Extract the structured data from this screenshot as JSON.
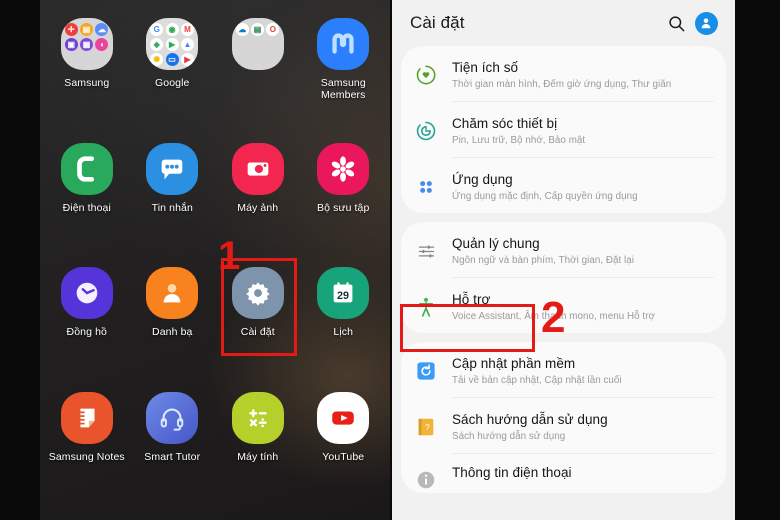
{
  "home_screen": {
    "apps": [
      {
        "label": "Samsung",
        "type": "folder",
        "icon_name": "samsung-folder-icon",
        "mini_icons": [
          {
            "name": "samsung-health-icon",
            "color": "#e8413c",
            "char": "+"
          },
          {
            "name": "samsung-notes-icon",
            "color": "#f5a623",
            "char": ""
          },
          {
            "name": "samsung-cloud-icon",
            "color": "#5b8df6",
            "char": ""
          },
          {
            "name": "galaxy-store-icon",
            "color": "#6d3fd6",
            "char": ""
          },
          {
            "name": "samsung-pay-icon",
            "color": "#7b4fd9",
            "char": ""
          },
          {
            "name": "samsung-tv-icon",
            "color": "#e8469c",
            "char": ""
          }
        ]
      },
      {
        "label": "Google",
        "type": "folder",
        "icon_name": "google-folder-icon",
        "mini_icons": [
          {
            "name": "google-search-icon",
            "color": "#ffffff",
            "char": "G"
          },
          {
            "name": "chrome-icon",
            "color": "#34a853",
            "char": ""
          },
          {
            "name": "gmail-icon",
            "color": "#ea4335",
            "char": "M"
          },
          {
            "name": "google-maps-icon",
            "color": "#ffffff",
            "char": ""
          },
          {
            "name": "play-store-icon",
            "color": "#ffffff",
            "char": ""
          },
          {
            "name": "google-drive-icon",
            "color": "#ffffff",
            "char": ""
          },
          {
            "name": "google-photos-icon",
            "color": "#ffffff",
            "char": ""
          },
          {
            "name": "google-duo-icon",
            "color": "#1a73e8",
            "char": ""
          },
          {
            "name": "google-play-movies-icon",
            "color": "#e53935",
            "char": ""
          }
        ]
      },
      {
        "label": "",
        "type": "folder",
        "icon_name": "microsoft-folder-icon",
        "mini_icons": [
          {
            "name": "onedrive-icon",
            "color": "#0f7ec8",
            "char": ""
          },
          {
            "name": "excel-icon",
            "color": "#1b7d4b",
            "char": ""
          },
          {
            "name": "office-icon",
            "color": "#e8413c",
            "char": "O"
          }
        ]
      },
      {
        "label": "Samsung Members",
        "type": "app",
        "icon_name": "samsung-members-icon",
        "color": "#2d7ff9"
      },
      {
        "label": "Điện thoại",
        "type": "app",
        "icon_name": "phone-icon",
        "color": "#2ba85c"
      },
      {
        "label": "Tin nhắn",
        "type": "app",
        "icon_name": "messages-icon",
        "color": "#2d8fe0"
      },
      {
        "label": "Máy ảnh",
        "type": "app",
        "icon_name": "camera-icon",
        "color": "#f0274f"
      },
      {
        "label": "Bộ sưu tập",
        "type": "app",
        "icon_name": "gallery-icon",
        "color": "#e8185d"
      },
      {
        "label": "Đồng hồ",
        "type": "app",
        "icon_name": "clock-icon",
        "color": "#5535d6"
      },
      {
        "label": "Danh bạ",
        "type": "app",
        "icon_name": "contacts-icon",
        "color": "#f58220"
      },
      {
        "label": "Cài đặt",
        "type": "app",
        "icon_name": "settings-gear-icon",
        "color": "#7e93ab"
      },
      {
        "label": "Lịch",
        "type": "app",
        "icon_name": "calendar-icon",
        "color": "#1aa37a",
        "badge": "29"
      },
      {
        "label": "Samsung Notes",
        "type": "app",
        "icon_name": "samsung-notes-icon",
        "color": "#e8552e"
      },
      {
        "label": "Smart Tutor",
        "type": "app",
        "icon_name": "smart-tutor-icon",
        "color": "#4f73d9"
      },
      {
        "label": "Máy tính",
        "type": "app",
        "icon_name": "calculator-icon",
        "color": "#b5cf2e"
      },
      {
        "label": "YouTube",
        "type": "app",
        "icon_name": "youtube-icon",
        "color": "#ffffff"
      }
    ]
  },
  "annotations": {
    "step1_number": "1",
    "step1_target": "Cài đặt",
    "step2_number": "2",
    "step2_target": "Hỗ trợ",
    "highlight_color": "#e01b17"
  },
  "settings": {
    "header": {
      "title": "Cài đặt",
      "search_icon": "search-icon",
      "account_icon": "account-avatar-icon"
    },
    "groups": [
      {
        "group_name": "digital-wellbeing-group",
        "items": [
          {
            "title": "Tiện ích số",
            "subtitle": "Thời gian màn hình, Đếm giờ ứng dụng, Thư giãn",
            "icon_name": "digital-wellbeing-icon",
            "icon_color": "#5aa02c"
          },
          {
            "title": "Chăm sóc thiết bị",
            "subtitle": "Pin, Lưu trữ, Bộ nhớ, Bảo mật",
            "icon_name": "device-care-icon",
            "icon_color": "#2fa39a"
          },
          {
            "title": "Ứng dụng",
            "subtitle": "Ứng dụng mặc định, Cấp quyền ứng dụng",
            "icon_name": "apps-grid-icon",
            "icon_color": "#4a8ce8"
          }
        ]
      },
      {
        "group_name": "general-group",
        "items": [
          {
            "title": "Quản lý chung",
            "subtitle": "Ngôn ngữ và bàn phím, Thời gian, Đặt lại",
            "icon_name": "sliders-icon",
            "icon_color": "#7a7a7a"
          },
          {
            "title": "Hỗ trợ",
            "subtitle": "Voice Assistant, Âm thanh mono, menu Hỗ trợ",
            "icon_name": "accessibility-icon",
            "icon_color": "#4caf50",
            "highlighted": true
          }
        ]
      },
      {
        "group_name": "system-group",
        "items": [
          {
            "title": "Cập nhật phần mềm",
            "subtitle": "Tải về bản cập nhật, Cập nhật lần cuối",
            "icon_name": "software-update-icon",
            "icon_color": "#3d9bf5"
          },
          {
            "title": "Sách hướng dẫn sử dụng",
            "subtitle": "Sách hướng dẫn sử dụng",
            "icon_name": "user-manual-icon",
            "icon_color": "#f0b43c"
          },
          {
            "title": "Thông tin điện thoại",
            "subtitle": "",
            "icon_name": "phone-info-icon",
            "icon_color": "#9e9e9e"
          }
        ]
      }
    ]
  }
}
